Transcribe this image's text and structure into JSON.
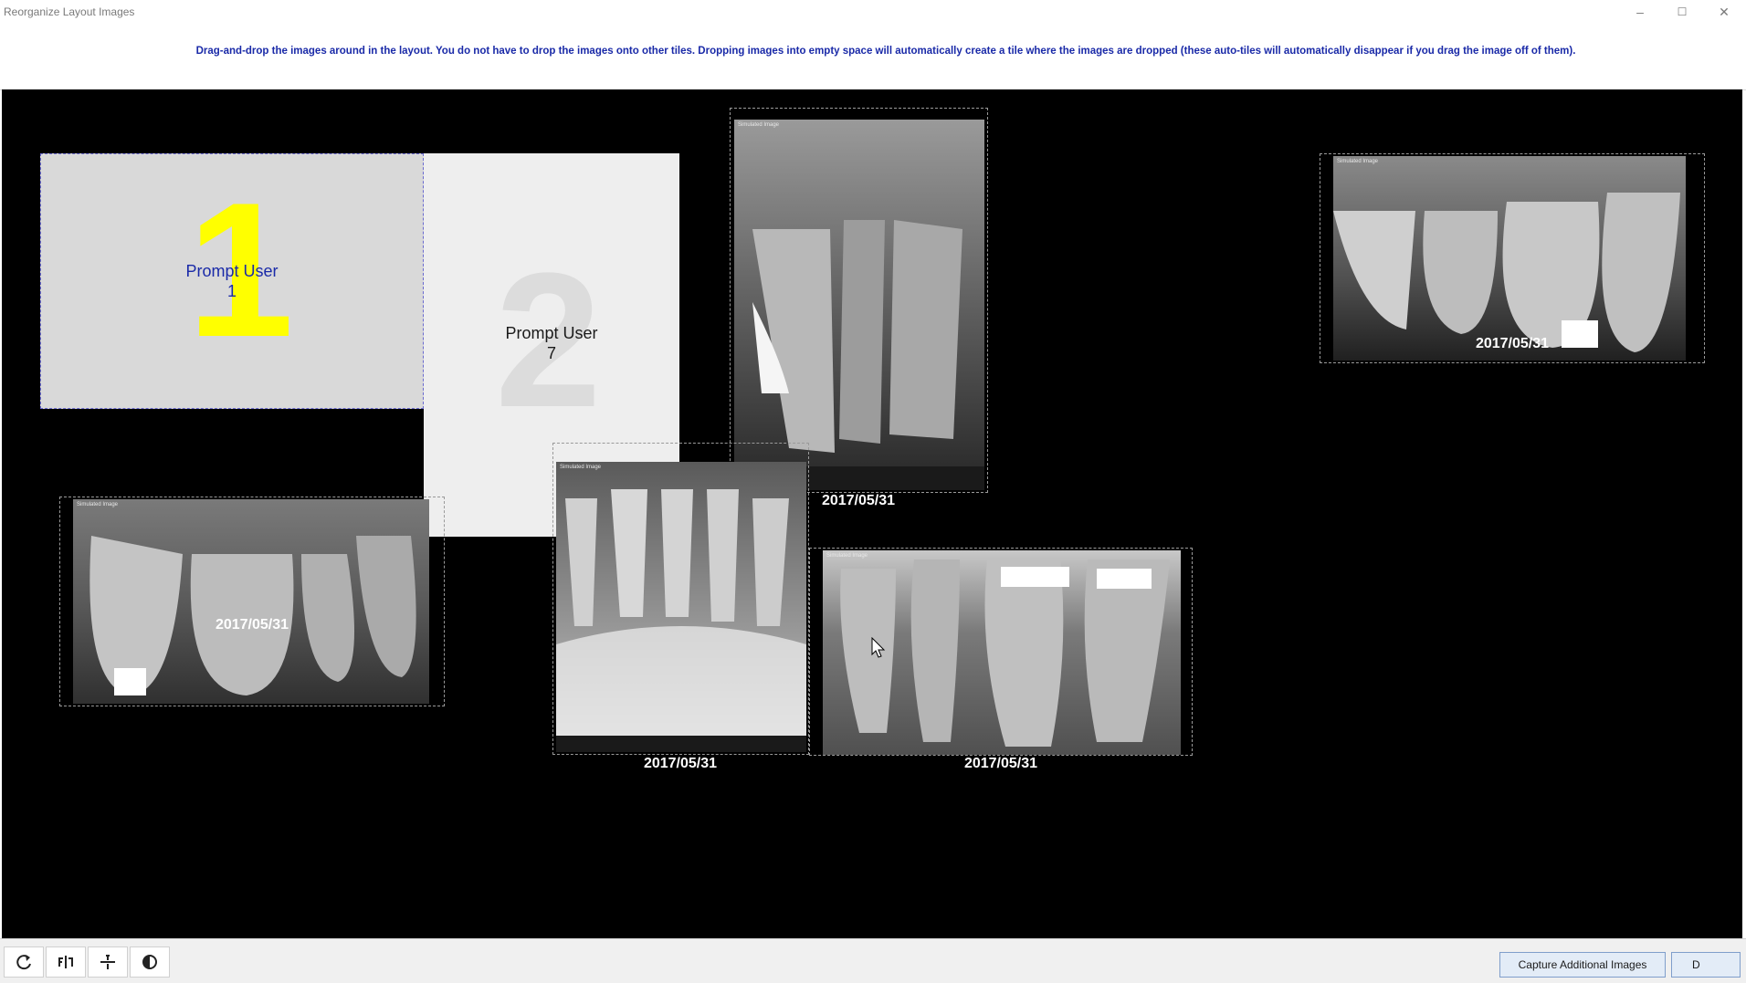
{
  "window": {
    "title": "Reorganize Layout Images",
    "minimize": "–",
    "maximize": "☐",
    "close": "✕"
  },
  "instructions": "Drag-and-drop the images around in the layout.  You do not have to drop the images onto other tiles.  Dropping images into empty space will automatically create a tile where the images are dropped (these auto-tiles will automatically disappear if you drag the image off of them).",
  "tiles": {
    "tile1": {
      "number": "1",
      "label_line1": "Prompt User",
      "label_line2": "1"
    },
    "tile2": {
      "number": "2",
      "label_line1": "Prompt User",
      "label_line2": "7"
    }
  },
  "images": [
    {
      "sim_label": "Simulated Image",
      "date": "2017/05/31"
    },
    {
      "sim_label": "Simulated Image",
      "date": "2017/05/31"
    },
    {
      "sim_label": "Simulated Image",
      "date": "2017/05/31"
    },
    {
      "sim_label": "Simulated Image",
      "date": "2017/05/31"
    },
    {
      "sim_label": "Simulated Image",
      "date": "2017/05/31"
    }
  ],
  "toolbar": {
    "capture_label": "Capture Additional Images",
    "done_label": "D"
  },
  "colors": {
    "tile1_number": "#ffff00",
    "tile1_label": "#1a2aa8",
    "instruction_text": "#1a2aa8"
  },
  "icons": [
    "rotate-icon",
    "flip-horizontal-icon",
    "flip-vertical-icon",
    "contrast-icon"
  ]
}
